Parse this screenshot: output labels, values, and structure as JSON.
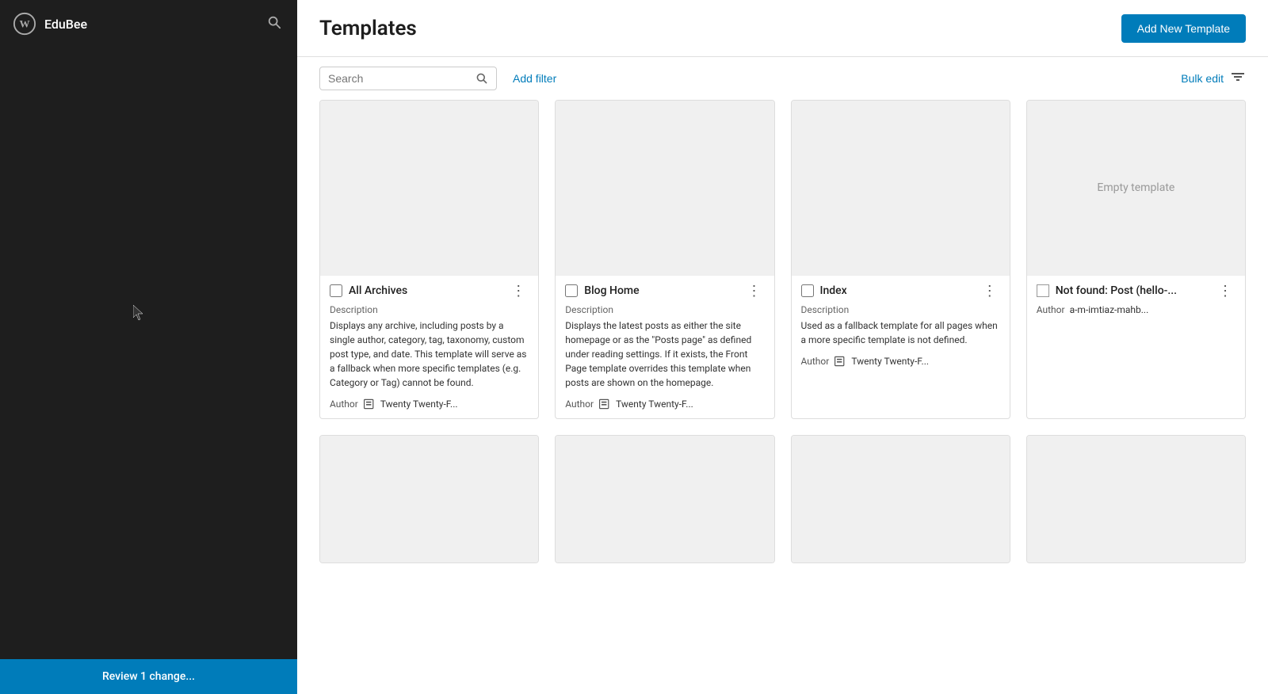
{
  "sidebar": {
    "brand_logo_label": "WordPress Logo",
    "brand_name": "EduBee",
    "search_label": "Search",
    "review_bar_label": "Review 1 change..."
  },
  "header": {
    "title": "Templates",
    "add_button_label": "Add New Template"
  },
  "toolbar": {
    "search_placeholder": "Search",
    "add_filter_label": "Add filter",
    "bulk_edit_label": "Bulk edit",
    "filter_icon_label": "Filter options"
  },
  "templates": [
    {
      "id": "all-archives",
      "name": "All Archives",
      "description_label": "Description",
      "description": "Displays any archive, including posts by a single author, category, tag, taxonomy, custom post type, and date. This template will serve as a fallback when more specific templates (e.g. Category or Tag) cannot be found.",
      "author_label": "Author",
      "author": "Twenty Twenty-F...",
      "empty": false
    },
    {
      "id": "blog-home",
      "name": "Blog Home",
      "description_label": "Description",
      "description": "Displays the latest posts as either the site homepage or as the \"Posts page\" as defined under reading settings. If it exists, the Front Page template overrides this template when posts are shown on the homepage.",
      "author_label": "Author",
      "author": "Twenty Twenty-F...",
      "empty": false
    },
    {
      "id": "index",
      "name": "Index",
      "description_label": "Description",
      "description": "Used as a fallback template for all pages when a more specific template is not defined.",
      "author_label": "Author",
      "author": "Twenty Twenty-F...",
      "empty": false
    },
    {
      "id": "not-found",
      "name": "Not found: Post (hello-...",
      "description_label": "",
      "description": "",
      "author_label": "Author",
      "author": "a-m-imtiaz-mahb...",
      "empty": true,
      "empty_label": "Empty template"
    },
    {
      "id": "row2-col1",
      "name": "",
      "description_label": "",
      "description": "",
      "author_label": "",
      "author": "",
      "empty": false,
      "preview_only": true
    },
    {
      "id": "row2-col2",
      "name": "",
      "description_label": "",
      "description": "",
      "author_label": "",
      "author": "",
      "empty": false,
      "preview_only": true
    },
    {
      "id": "row2-col3",
      "name": "",
      "description_label": "",
      "description": "",
      "author_label": "",
      "author": "",
      "empty": false,
      "preview_only": true
    },
    {
      "id": "row2-col4",
      "name": "",
      "description_label": "",
      "description": "",
      "author_label": "",
      "author": "",
      "empty": false,
      "preview_only": true
    }
  ]
}
